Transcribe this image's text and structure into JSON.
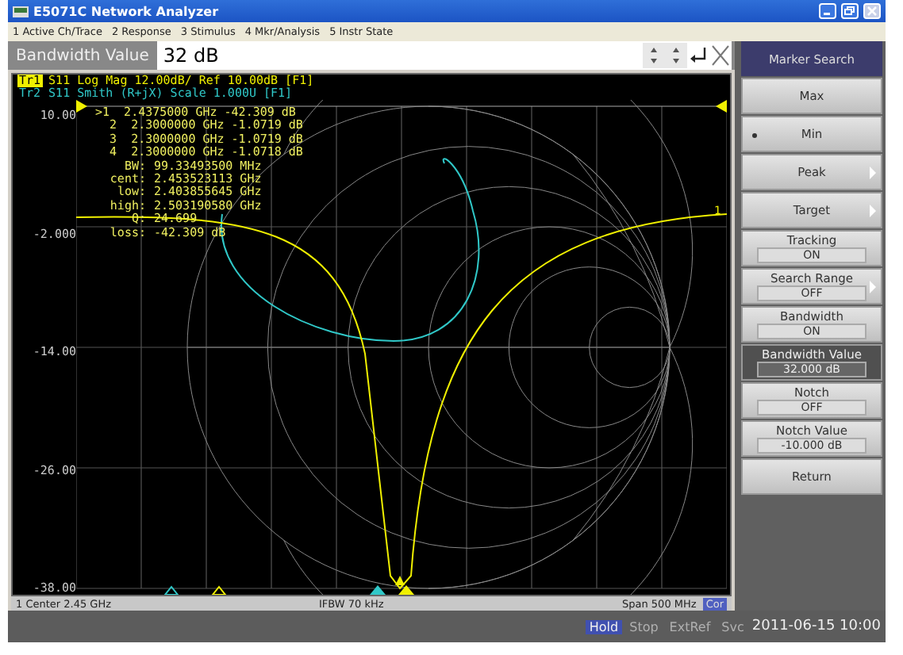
{
  "window": {
    "title": "E5071C Network Analyzer"
  },
  "menu": [
    "1 Active Ch/Trace",
    "2 Response",
    "3 Stimulus",
    "4 Mkr/Analysis",
    "5 Instr State"
  ],
  "entry": {
    "label": "Bandwidth Value",
    "value": "32 dB"
  },
  "trace_labels": [
    {
      "name": "Tr1",
      "text": "S11 Log Mag 12.00dB/ Ref 10.00dB [F1]",
      "selected": true,
      "color": "#f0f000"
    },
    {
      "name": "Tr2",
      "text": "S11 Smith (R+jX) Scale 1.000U [F1]",
      "selected": false,
      "color": "#30c8c8"
    }
  ],
  "y_axis_labels": [
    "10.00",
    "-2.000",
    "-14.00",
    "-26.00",
    "-38.00"
  ],
  "ref_line_label": "1",
  "marker_readouts": [
    ">1  2.4375000 GHz -42.309 dB",
    "  2  2.3000000 GHz -1.0719 dB",
    "  3  2.3000000 GHz -1.0719 dB",
    "  4  2.3000000 GHz -1.0718 dB"
  ],
  "bandwidth_readouts": [
    {
      "label": "BW:",
      "value": "99.33493500 MHz"
    },
    {
      "label": "cent:",
      "value": "2.453523113 GHz"
    },
    {
      "label": "low:",
      "value": "2.403855645 GHz"
    },
    {
      "label": "high:",
      "value": "2.503190580 GHz"
    },
    {
      "label": "Q:",
      "value": "24.699"
    },
    {
      "label": "loss:",
      "value": "-42.309 dB"
    }
  ],
  "channel_footer": {
    "center": "1  Center 2.45 GHz",
    "ifbw": "IFBW 70 kHz",
    "span": "Span 500 MHz",
    "correction": "Cor"
  },
  "softkeys": [
    {
      "kind": "header",
      "label": "Marker Search"
    },
    {
      "kind": "action",
      "label": "Max",
      "selected": false,
      "active": false,
      "submenu": false
    },
    {
      "kind": "action",
      "label": "Min",
      "selected": true,
      "active": false,
      "submenu": false
    },
    {
      "kind": "action",
      "label": "Peak",
      "selected": false,
      "active": false,
      "submenu": true
    },
    {
      "kind": "action",
      "label": "Target",
      "selected": false,
      "active": false,
      "submenu": true
    },
    {
      "kind": "setting",
      "label": "Tracking",
      "value": "ON",
      "selected": false,
      "active": false,
      "submenu": false
    },
    {
      "kind": "setting",
      "label": "Search Range",
      "value": "OFF",
      "selected": false,
      "active": false,
      "submenu": true
    },
    {
      "kind": "setting",
      "label": "Bandwidth",
      "value": "ON",
      "selected": false,
      "active": false,
      "submenu": false
    },
    {
      "kind": "setting",
      "label": "Bandwidth Value",
      "value": "32.000 dB",
      "selected": false,
      "active": true,
      "submenu": false
    },
    {
      "kind": "setting",
      "label": "Notch",
      "value": "OFF",
      "selected": false,
      "active": false,
      "submenu": false
    },
    {
      "kind": "setting",
      "label": "Notch Value",
      "value": "-10.000 dB",
      "selected": false,
      "active": false,
      "submenu": false
    },
    {
      "kind": "action",
      "label": "Return",
      "selected": false,
      "active": false,
      "submenu": false
    }
  ],
  "status_indicators": [
    {
      "label": "Hold",
      "on": true
    },
    {
      "label": "Stop",
      "on": false
    },
    {
      "label": "ExtRef",
      "on": false
    },
    {
      "label": "Svc",
      "on": false
    }
  ],
  "datetime": "2011-06-15 10:00"
}
